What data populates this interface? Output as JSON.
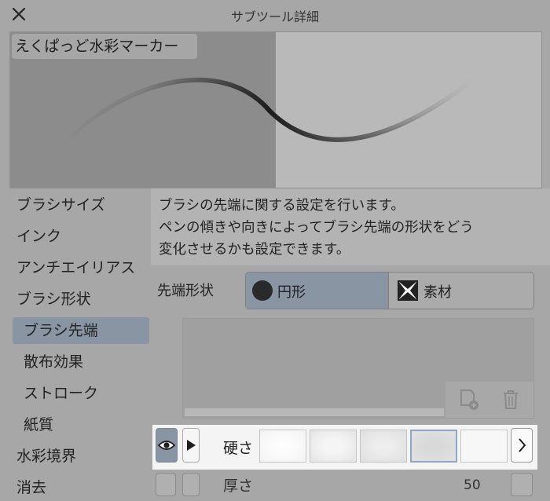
{
  "window": {
    "title": "サブツール詳細"
  },
  "preview": {
    "brush_name": "えくぱっど水彩マーカー"
  },
  "sidebar": {
    "items": [
      {
        "label": "ブラシサイズ"
      },
      {
        "label": "インク"
      },
      {
        "label": "アンチエイリアス"
      },
      {
        "label": "ブラシ形状"
      },
      {
        "label": "ブラシ先端",
        "selected": true
      },
      {
        "label": "散布効果"
      },
      {
        "label": "ストローク"
      },
      {
        "label": "紙質"
      },
      {
        "label": "水彩境界"
      },
      {
        "label": "消去"
      }
    ]
  },
  "description": {
    "lines": [
      "ブラシの先端に関する設定を行います。",
      "ペンの傾きや向きによってブラシ先端の形状をどう",
      "変化させるかも設定できます。"
    ]
  },
  "tip_shape": {
    "label": "先端形状",
    "options": [
      {
        "label": "円形",
        "icon": "circle-icon",
        "selected": true
      },
      {
        "label": "素材",
        "icon": "material-icon",
        "selected": false
      }
    ]
  },
  "tip_buttons": {
    "add_icon": "add-tip-icon",
    "delete_icon": "trash-icon"
  },
  "hardness": {
    "label": "硬さ",
    "selected_index": 3,
    "swatch_count": 5
  },
  "thickness": {
    "label": "厚さ",
    "value": "50"
  },
  "colors": {
    "selection": "#8a95a4",
    "background": "#a7a7a7"
  }
}
